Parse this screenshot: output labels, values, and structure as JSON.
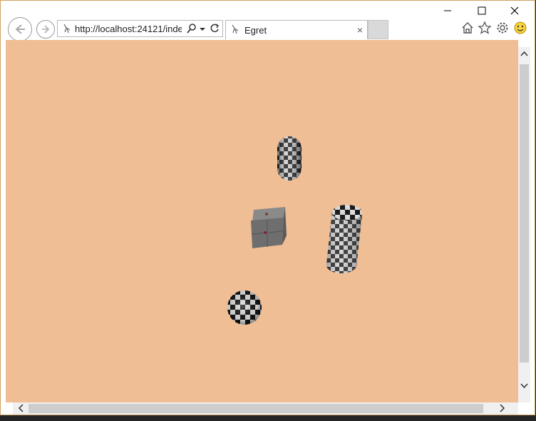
{
  "browser": {
    "address_url": "http://localhost:24121/inde",
    "tab_title": "Egret",
    "tab_close": "×",
    "window_controls": {
      "minimize": "minimize-icon",
      "maximize": "maximize-icon",
      "close": "close-icon"
    }
  },
  "toolbar_icons": [
    "home-icon",
    "favorites-star-icon",
    "settings-gear-icon",
    "feedback-smiley-icon"
  ],
  "scene": {
    "background_color": "#f0be94",
    "objects": [
      "capsule",
      "cube",
      "cylinder",
      "sphere"
    ]
  }
}
